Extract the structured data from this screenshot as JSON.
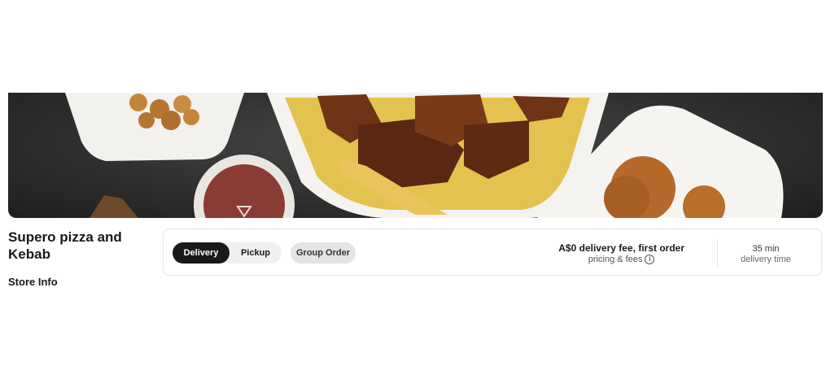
{
  "hero": {
    "image": "store-banner-photo",
    "description": "food trays with fries, ribs and fried chicken"
  },
  "store": {
    "name": "Supero pizza and Kebab",
    "info_label": "Store Info"
  },
  "order_options": {
    "fulfillment": {
      "active": "Delivery",
      "inactive": "Pickup"
    },
    "group_order_label": "Group Order"
  },
  "fees": {
    "headline": "A$0 delivery fee, first order",
    "sub_label": "pricing & fees",
    "info_icon": "info-icon"
  },
  "delivery": {
    "time": "35 min",
    "time_label": "delivery time"
  },
  "colors": {
    "active_toggle": "#191919",
    "toggle_bg": "#f0f0f0",
    "group_btn_bg": "#e4e4e4"
  }
}
